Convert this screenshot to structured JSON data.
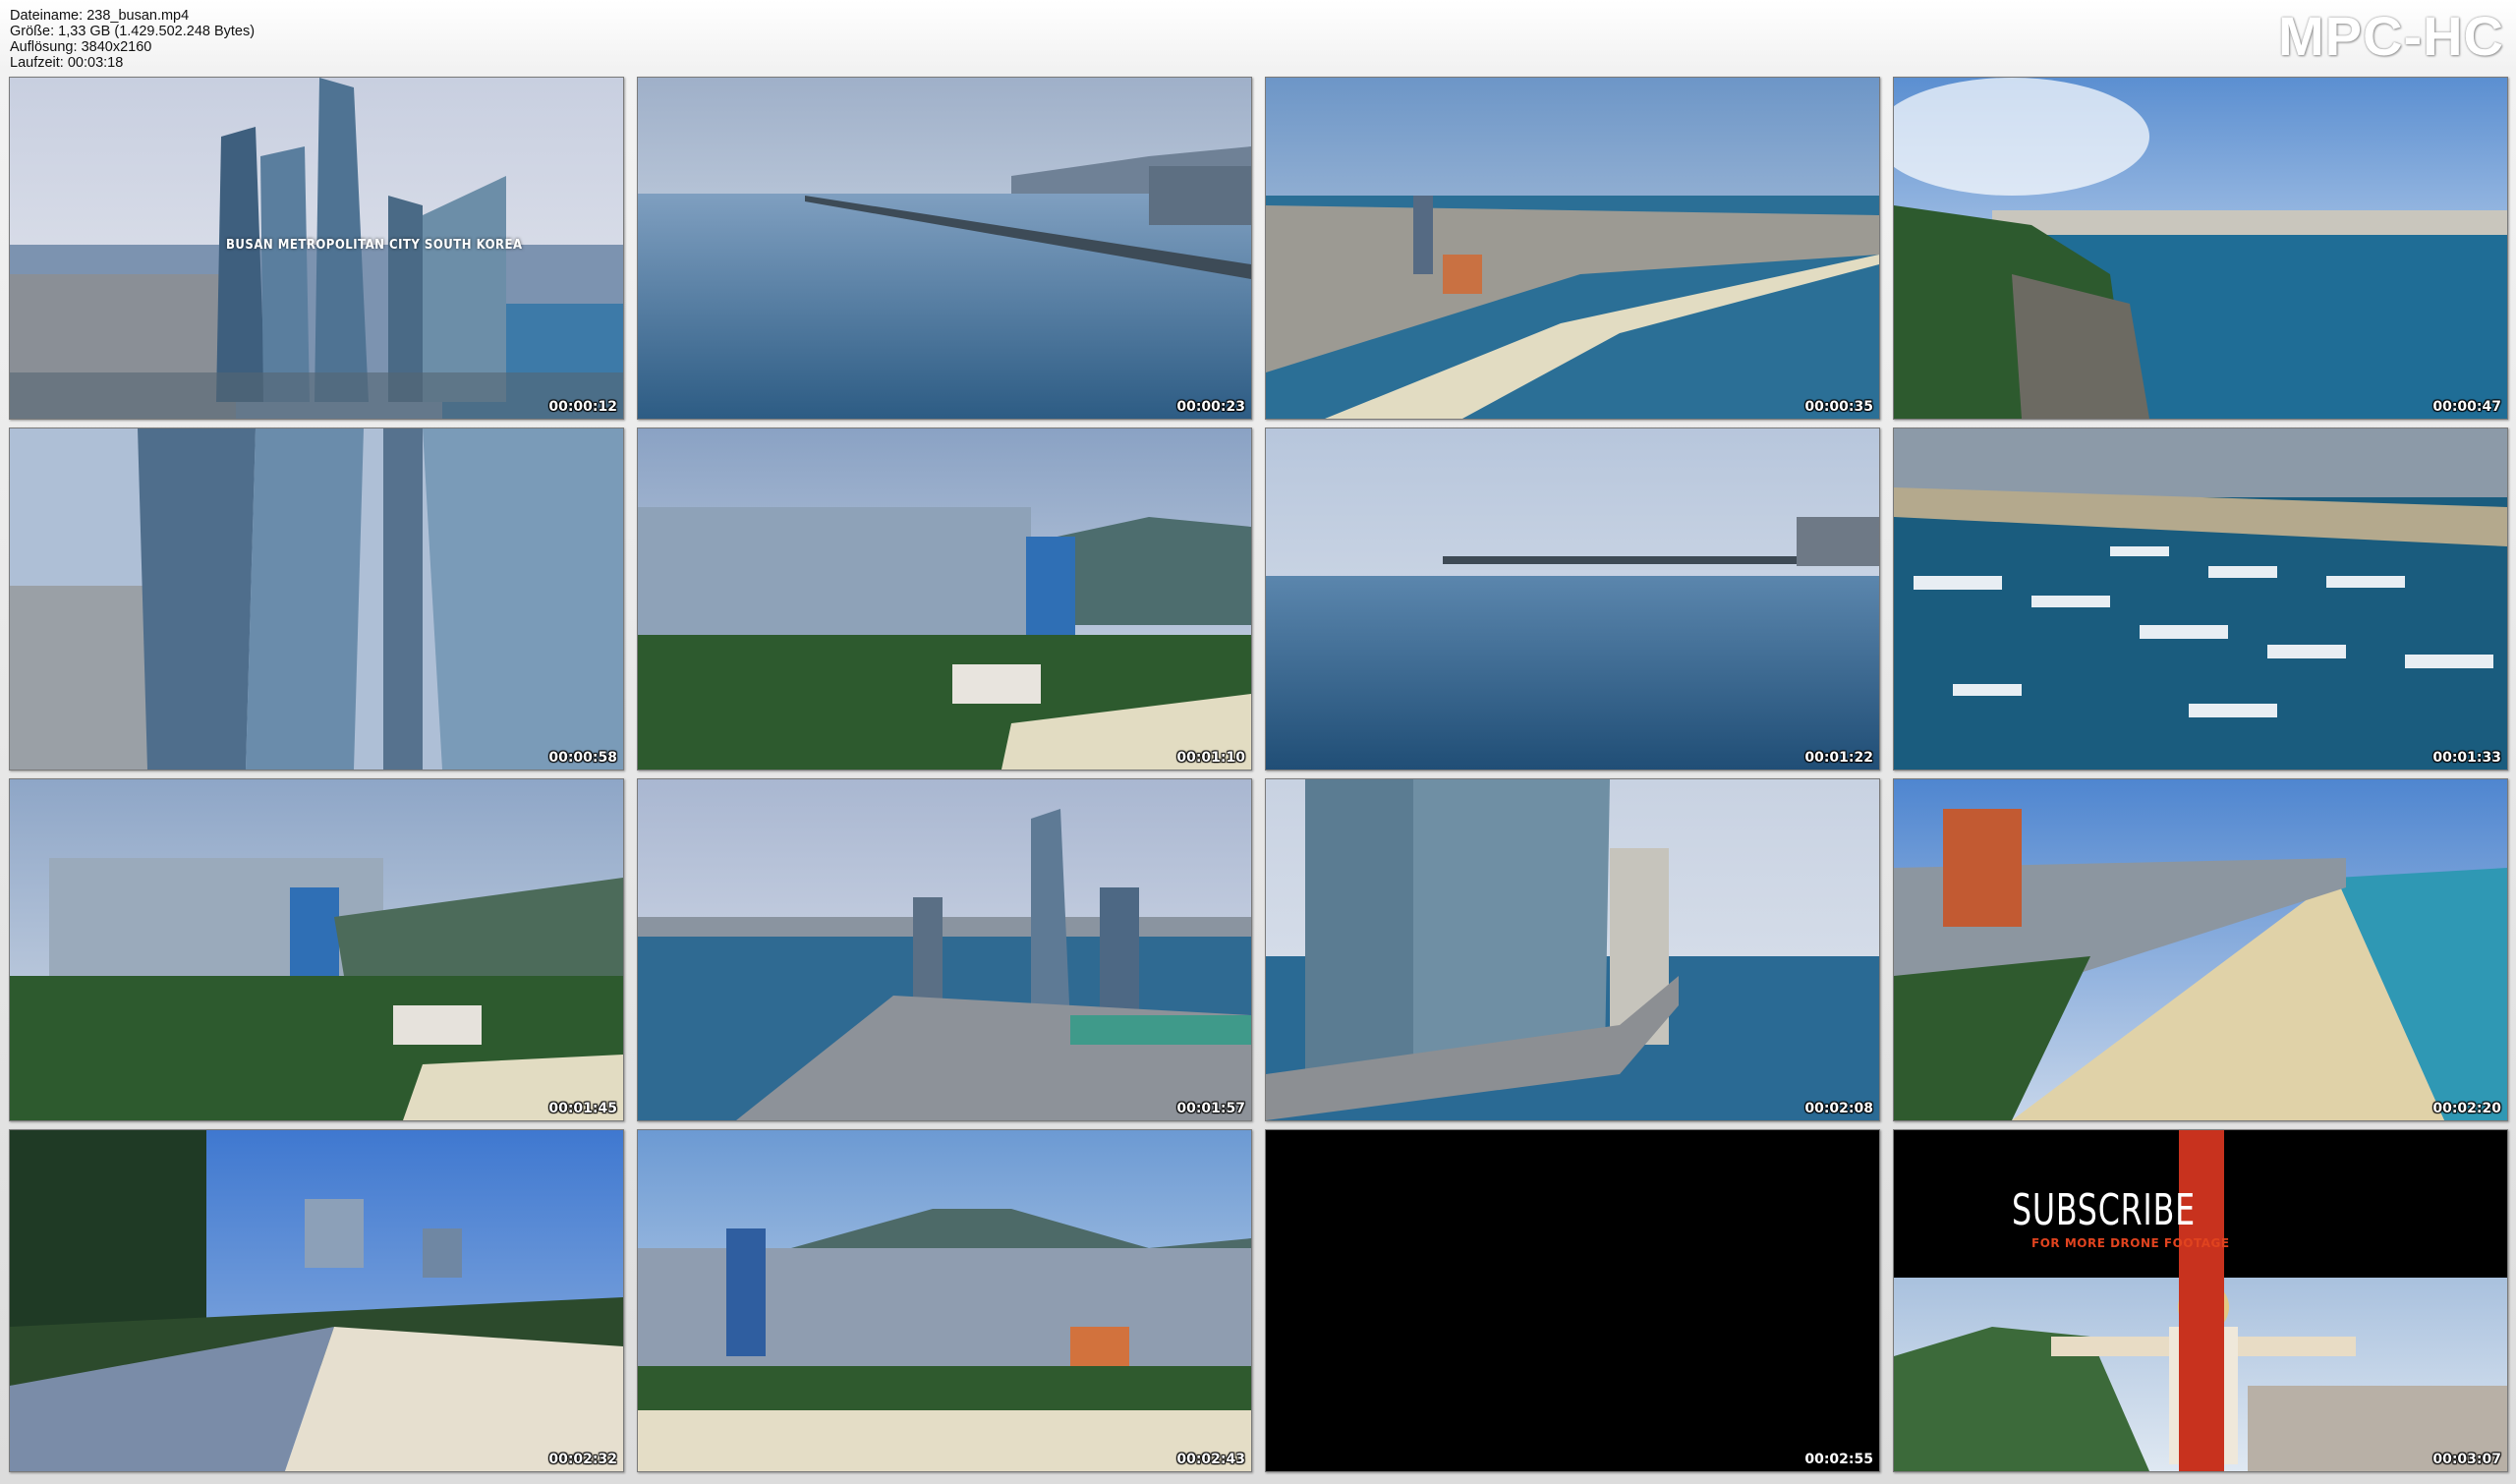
{
  "header": {
    "info": [
      {
        "label": "Dateiname",
        "value": "238_busan.mp4"
      },
      {
        "label": "Größe",
        "value": "1,33 GB (1.429.502.248 Bytes)"
      },
      {
        "label": "Auflösung",
        "value": "3840x2160"
      },
      {
        "label": "Laufzeit",
        "value": "00:03:18"
      }
    ],
    "brand": "MPC-HC"
  },
  "thumbnails": [
    {
      "time": "00:00:12",
      "overlay": "BUSAN METROPOLITAN CITY  SOUTH KOREA"
    },
    {
      "time": "00:00:23"
    },
    {
      "time": "00:00:35"
    },
    {
      "time": "00:00:47"
    },
    {
      "time": "00:00:58"
    },
    {
      "time": "00:01:10"
    },
    {
      "time": "00:01:22"
    },
    {
      "time": "00:01:33"
    },
    {
      "time": "00:01:45"
    },
    {
      "time": "00:01:57"
    },
    {
      "time": "00:02:08"
    },
    {
      "time": "00:02:20"
    },
    {
      "time": "00:02:32"
    },
    {
      "time": "00:02:43"
    },
    {
      "time": "00:02:55"
    },
    {
      "time": "00:03:07",
      "subscribe": "SUBSCRIBE",
      "subscribe_sub": "FOR MORE DRONE FOOTAGE"
    }
  ],
  "colors": {
    "sky": "#9fb7d6",
    "sea": "#2f6a92",
    "sand": "#d8cfae",
    "forest": "#2f5a2e",
    "subscribe_red": "#c8321e"
  }
}
